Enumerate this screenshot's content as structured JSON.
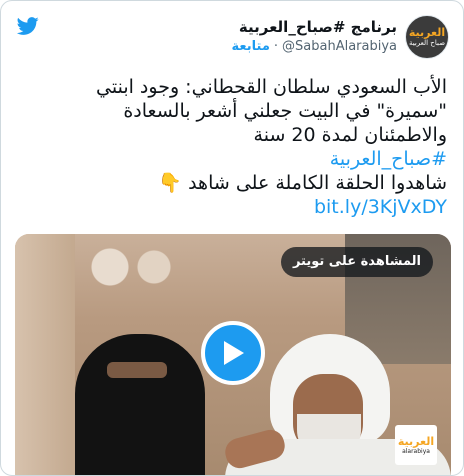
{
  "author": {
    "display_name": "برنامج #صباح_العربية",
    "handle": "@SabahAlarabiya",
    "separator": "·",
    "follow_label": "متابعة",
    "avatar_logo_main": "العربية",
    "avatar_logo_sub": "صباح العربية"
  },
  "tweet": {
    "line1": "الأب السعودي سلطان القحطاني: وجود ابنتي",
    "line2": "\"سميرة\" في البيت جعلني أشعر بالسعادة",
    "line3": "والاطمئنان لمدة 20 سنة",
    "hashtag": "#صباح_العربية",
    "line5": "شاهدوا الحلقة الكاملة على شاهد 👇",
    "link": "bit.ly/3KjVxDY"
  },
  "media": {
    "watch_label": "المشاهدة على تويتر",
    "channel_logo_main": "العربية",
    "channel_logo_sub": "alarabiya"
  },
  "colors": {
    "accent": "#1d9bf0",
    "text": "#0f1419",
    "secondary": "#536471"
  },
  "icons": {
    "brand": "twitter-bird-icon",
    "play": "play-icon"
  }
}
